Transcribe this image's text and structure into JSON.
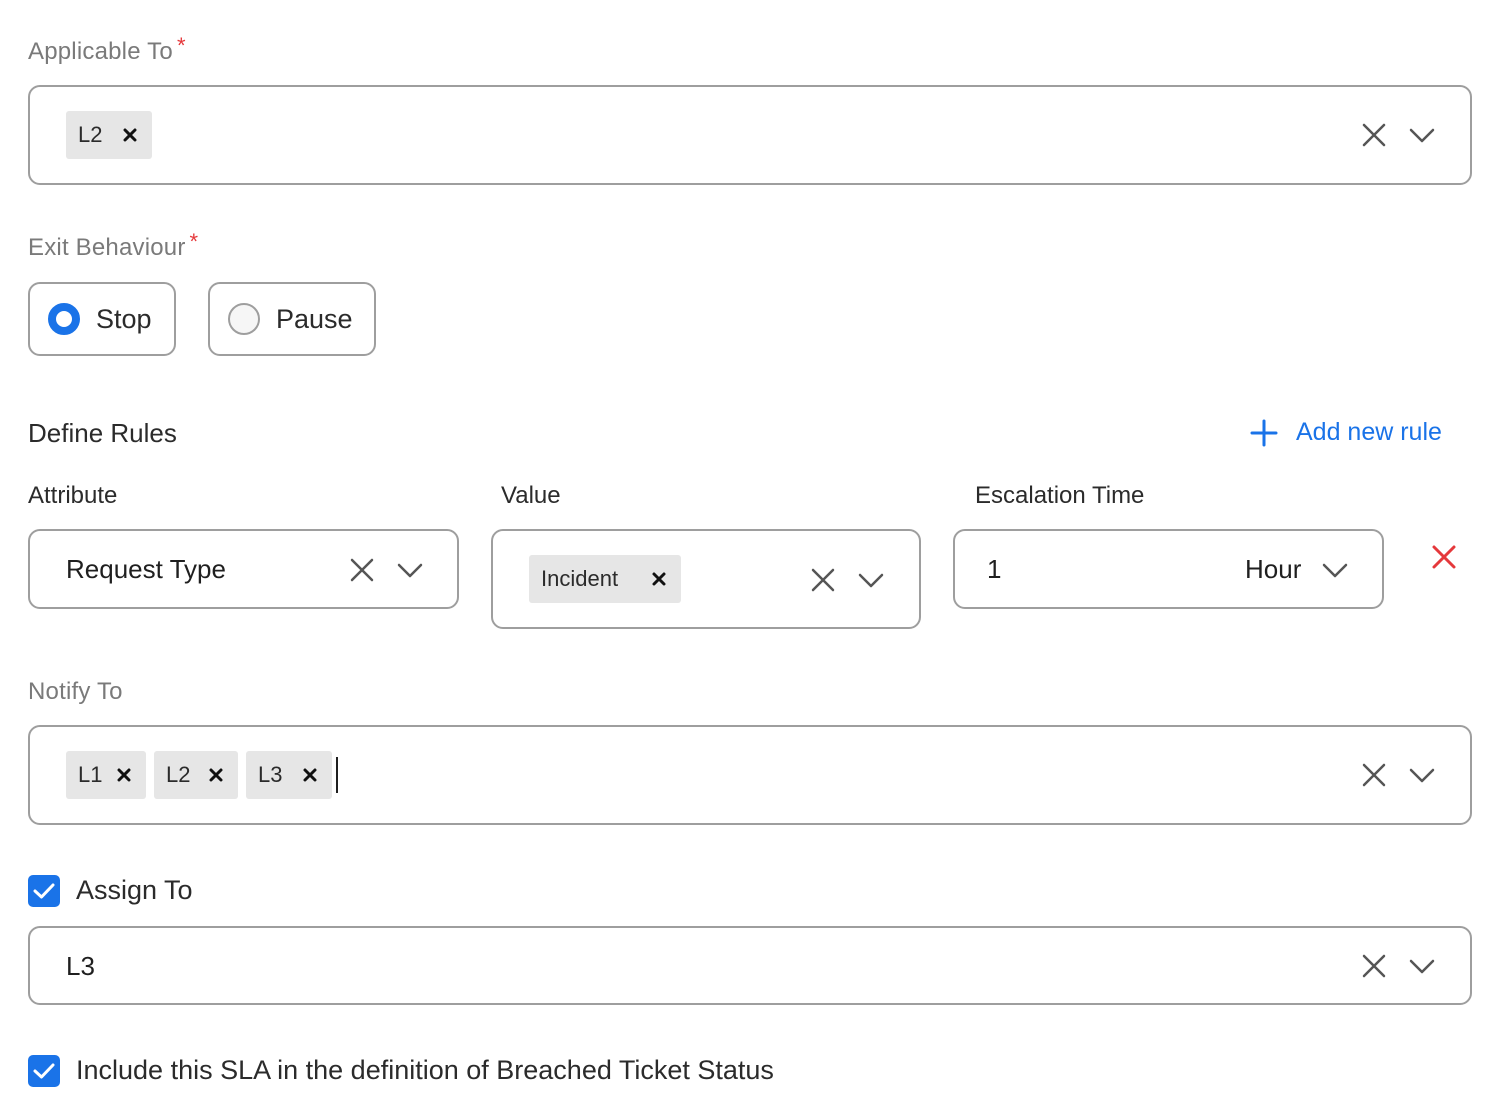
{
  "applicable_to": {
    "label": "Applicable To",
    "required_mark": "*",
    "chips": [
      "L2"
    ]
  },
  "exit_behaviour": {
    "label": "Exit Behaviour",
    "required_mark": "*",
    "options": [
      {
        "label": "Stop",
        "selected": true
      },
      {
        "label": "Pause",
        "selected": false
      }
    ]
  },
  "define_rules": {
    "title": "Define Rules",
    "add_label": "Add new rule",
    "columns": {
      "attribute": "Attribute",
      "value": "Value",
      "escalation_time": "Escalation Time"
    },
    "rule": {
      "attribute": "Request Type",
      "value_chips": [
        "Incident"
      ],
      "time_value": "1",
      "time_unit": "Hour"
    }
  },
  "notify_to": {
    "label": "Notify To",
    "chips": [
      "L1",
      "L2",
      "L3"
    ]
  },
  "assign_to": {
    "label": "Assign To",
    "checked": true,
    "value": "L3"
  },
  "include_sla": {
    "label": "Include this SLA in the definition of Breached Ticket Status",
    "checked": true
  },
  "colors": {
    "accent": "#1a73e8",
    "danger": "#e5383b",
    "chip_bg": "#e6e6e6",
    "border": "#9e9e9e"
  },
  "icons": {
    "clear": "close-icon",
    "dropdown": "chevron-down-icon",
    "chip_remove": "close-icon",
    "add": "plus-icon",
    "delete_rule": "close-icon",
    "checkbox": "check-icon"
  }
}
